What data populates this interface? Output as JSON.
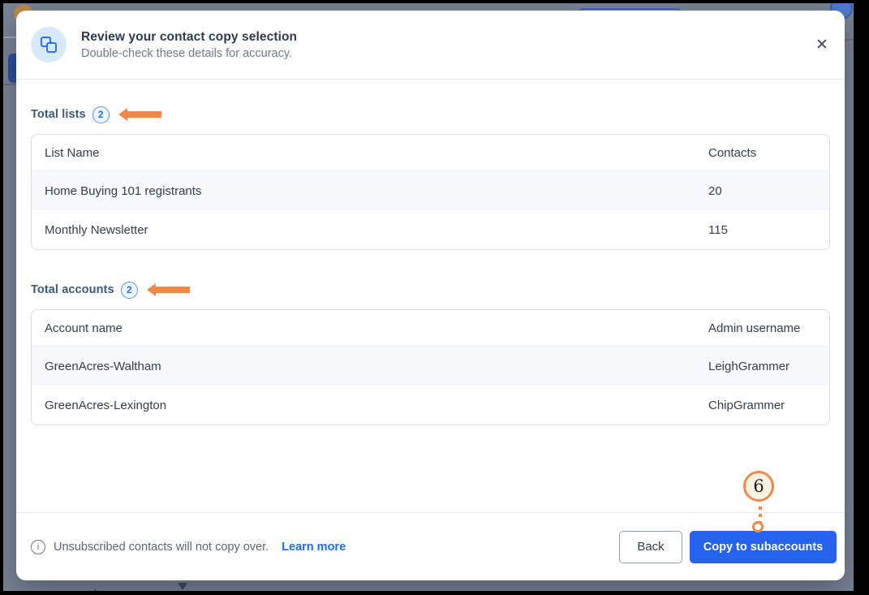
{
  "colors": {
    "primary_button_blue": "#2563ef",
    "link_blue": "#1b6ef3",
    "annotation_orange": "#ee8a4f",
    "badge_blue": "#2f6fdf",
    "header_icon_blue": "#2f6ef2",
    "overlay_gray": "#7a8393",
    "row_alt_background": "#f6f8fb"
  },
  "modal": {
    "header": {
      "icon": "copy-icon",
      "title": "Review your contact copy selection",
      "subtitle": "Double-check these details for accuracy.",
      "close_glyph": "✕"
    },
    "sections": [
      {
        "label": "Total lists",
        "badge_count": "2",
        "table": {
          "columns": [
            "List Name",
            "Contacts"
          ],
          "rows": [
            {
              "cells": [
                "Home Buying 101 registrants",
                "20"
              ]
            },
            {
              "cells": [
                "Monthly Newsletter",
                "115"
              ]
            }
          ]
        }
      },
      {
        "label": "Total accounts",
        "badge_count": "2",
        "table": {
          "columns": [
            "Account name",
            "Admin username"
          ],
          "rows": [
            {
              "cells": [
                "GreenAcres-Waltham",
                "LeighGrammer"
              ]
            },
            {
              "cells": [
                "GreenAcres-Lexington",
                "ChipGrammer"
              ]
            }
          ]
        }
      }
    ],
    "footer": {
      "info_icon_glyph": "i",
      "info_text": "Unsubscribed contacts will not copy over.",
      "learn_more_label": "Learn more",
      "back_label": "Back",
      "primary_label": "Copy to subaccounts"
    }
  },
  "annotation": {
    "step_number": "6"
  }
}
